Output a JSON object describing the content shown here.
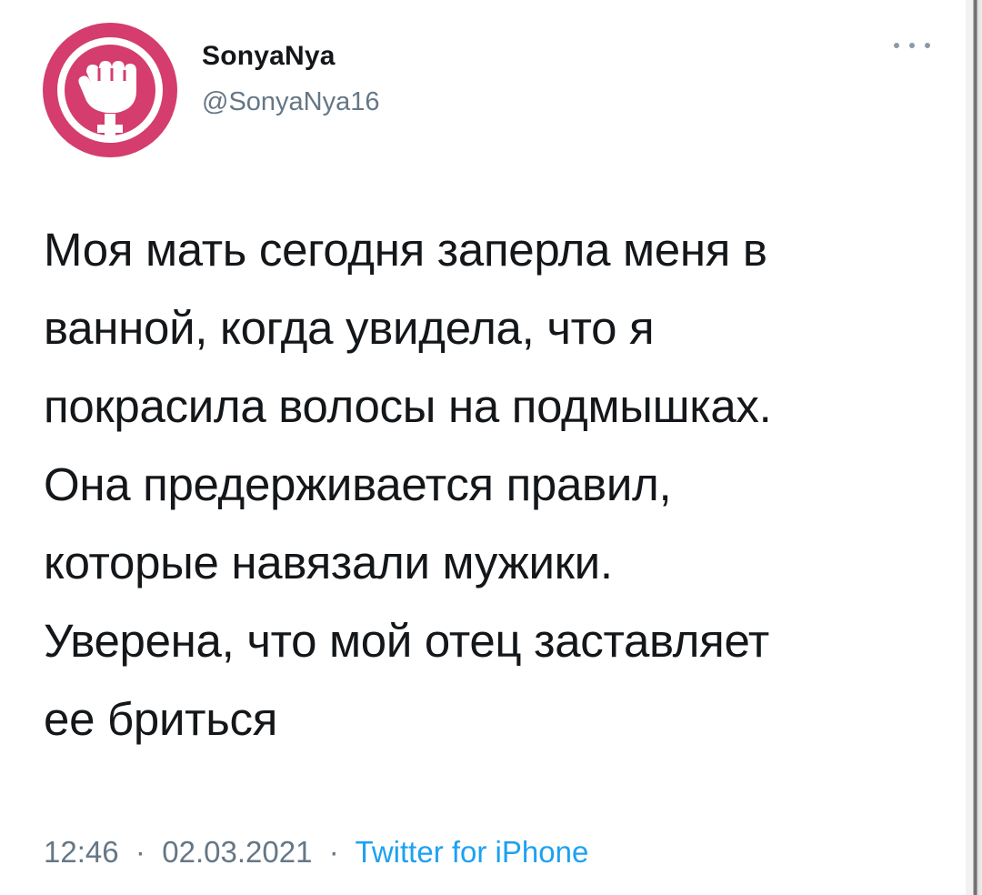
{
  "tweet": {
    "author": {
      "display_name": "SonyaNya",
      "handle": "@SonyaNya16",
      "avatar_icon": "raised-fist-venus-icon",
      "avatar_color": "#d43d6e"
    },
    "more_icon": "more-dots-icon",
    "text_lines": [
      "Моя мать сегодня заперла меня в",
      "ванной, когда увидела, что я",
      "покрасила волосы на подмышках.",
      "Она предерживается правил,",
      "которые навязали мужики.",
      "Уверена, что мой отец заставляет",
      "ее бриться"
    ],
    "time": "12:46",
    "separator": "·",
    "date": "02.03.2021",
    "source": "Twitter for iPhone",
    "source_color": "#1da1f2"
  }
}
